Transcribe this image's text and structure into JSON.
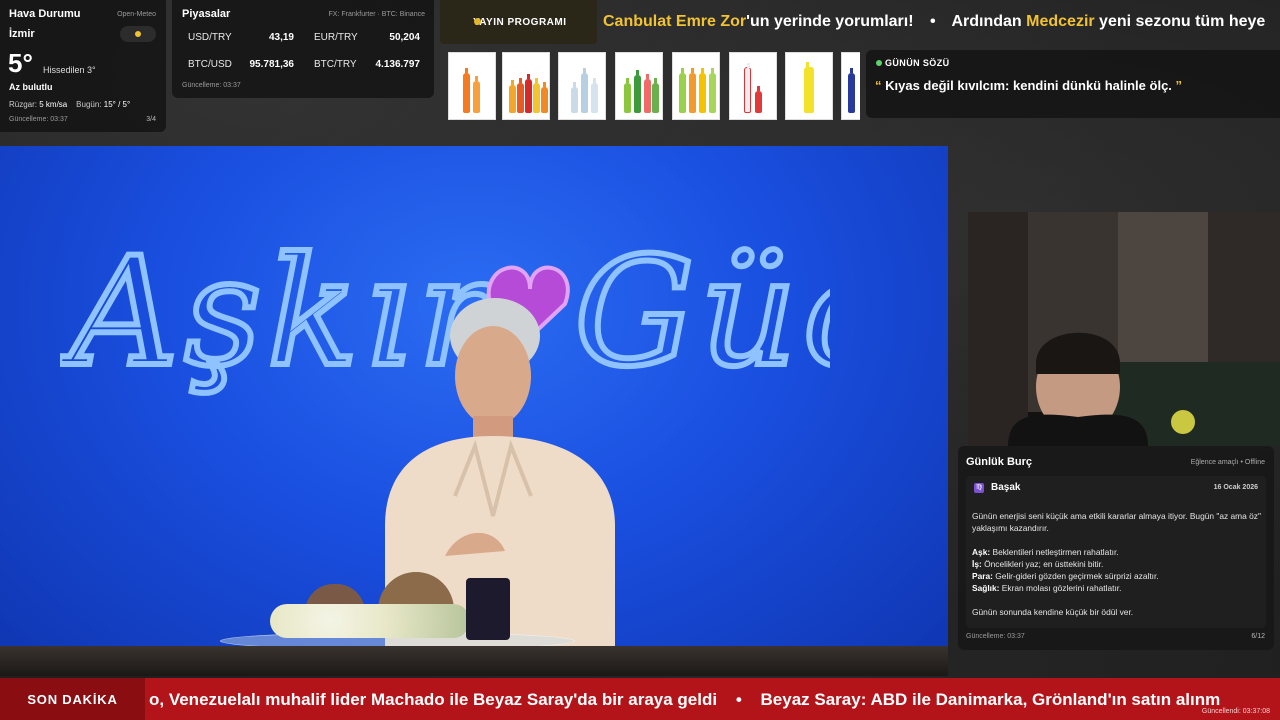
{
  "weather": {
    "title": "Hava Durumu",
    "source": "Open-Meteo",
    "city": "İzmir",
    "temp": "5°",
    "feels_like": "Hissedilen 3°",
    "condition": "Az bulutlu",
    "wind_label": "Rüzgar:",
    "wind_value": "5 km/sa",
    "today_label": "Bugün:",
    "today_value": "15° / 5°",
    "updated": "Güncelleme: 03:37",
    "page": "3/4",
    "icon": "partly-cloudy-icon"
  },
  "markets": {
    "title": "Piyasalar",
    "source": "FX: Frankfurter · BTC: Binance",
    "items": [
      {
        "label": "USD/TRY",
        "value": "43,19"
      },
      {
        "label": "EUR/TRY",
        "value": "50,204"
      },
      {
        "label": "BTC/USD",
        "value": "95.781,36"
      },
      {
        "label": "BTC/TRY",
        "value": "4.136.797"
      }
    ],
    "updated": "Güncelleme: 03:37"
  },
  "schedule": {
    "label": "YAYIN PROGRAMI",
    "segment1_highlight": "Canbulat Emre Zor",
    "segment1_text": "'un yerinde yorumları!",
    "separator": "•",
    "segment2_text": "Ardından ",
    "segment2_highlight": "Medcezir",
    "segment2_rest": " yeni sezonu tüm heye"
  },
  "quote": {
    "title": "GÜNÜN SÖZÜ",
    "open_mark": "“",
    "text": " Kıyas değil kıvılcım: kendini dünkü halinle ölç. ",
    "close_mark": "”"
  },
  "video": {
    "logo_text": "Aşkın Gücü"
  },
  "horoscope": {
    "title": "Günlük Burç",
    "tag": "Eğlence amaçlı • Offline",
    "sign_icon": "♍",
    "sign": "Başak",
    "date": "16 Ocak 2026",
    "intro": "Günün enerjisi seni küçük ama etkili kararlar almaya itiyor. Bugün \"az ama öz\" yaklaşımı kazandırır.",
    "love_label": "Aşk:",
    "love_text": " Beklentileri netleştirmen rahatlatır.",
    "work_label": "İş:",
    "work_text": " Öncelikleri yaz; en üsttekini bitir.",
    "money_label": "Para:",
    "money_text": " Gelir-gideri gözden geçirmek sürprizi azaltır.",
    "health_label": "Sağlık:",
    "health_text": " Ekran molası gözlerini rahatlatır.",
    "outro": "Günün sonunda kendine küçük bir ödül ver.",
    "updated": "Güncelleme: 03:37",
    "page": "6/12"
  },
  "breaking": {
    "label": "SON DAKİKA",
    "headline1": "o, Venezuelalı muhalif lider Machado ile Beyaz Saray'da bir araya geldi",
    "separator": "•",
    "headline2": "Beyaz Saray: ABD ile Danimarka, Grönland'ın satın alınm",
    "updated": "Güncellendi: 03:37:08"
  },
  "colors": {
    "accent_yellow": "#f1c232",
    "breaking_red": "#b3141a",
    "studio_blue": "#1a4fe0"
  }
}
